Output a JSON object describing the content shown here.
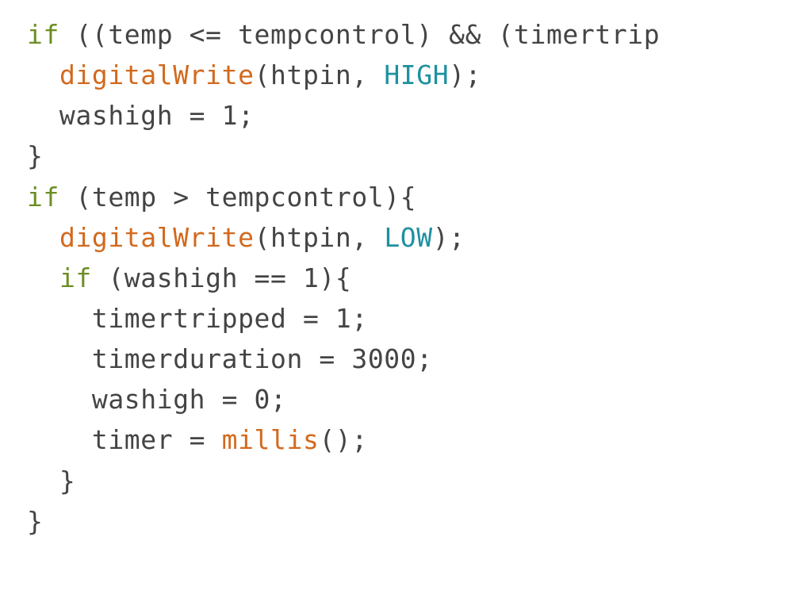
{
  "code": {
    "font_family": "monospace",
    "colors": {
      "keyword": "#6b8e23",
      "function": "#d2691e",
      "constant": "#1e90a0",
      "text": "#444444"
    },
    "lines": [
      [
        {
          "c": "kw",
          "t": "if"
        },
        {
          "c": "txt",
          "t": " ((temp <= tempcontrol) && (timertrip"
        }
      ],
      [
        {
          "c": "txt",
          "t": "  "
        },
        {
          "c": "fn",
          "t": "digitalWrite"
        },
        {
          "c": "txt",
          "t": "(htpin, "
        },
        {
          "c": "con",
          "t": "HIGH"
        },
        {
          "c": "txt",
          "t": ");"
        }
      ],
      [
        {
          "c": "txt",
          "t": "  washigh = 1;"
        }
      ],
      [
        {
          "c": "txt",
          "t": "}"
        }
      ],
      [
        {
          "c": "kw",
          "t": "if"
        },
        {
          "c": "txt",
          "t": " (temp > tempcontrol){"
        }
      ],
      [
        {
          "c": "txt",
          "t": "  "
        },
        {
          "c": "fn",
          "t": "digitalWrite"
        },
        {
          "c": "txt",
          "t": "(htpin, "
        },
        {
          "c": "con",
          "t": "LOW"
        },
        {
          "c": "txt",
          "t": ");"
        }
      ],
      [
        {
          "c": "txt",
          "t": "  "
        },
        {
          "c": "kw",
          "t": "if"
        },
        {
          "c": "txt",
          "t": " (washigh == 1){"
        }
      ],
      [
        {
          "c": "txt",
          "t": "    timertripped = 1;"
        }
      ],
      [
        {
          "c": "txt",
          "t": "    timerduration = 3000;"
        }
      ],
      [
        {
          "c": "txt",
          "t": "    washigh = 0;"
        }
      ],
      [
        {
          "c": "txt",
          "t": "    timer = "
        },
        {
          "c": "fn",
          "t": "millis"
        },
        {
          "c": "txt",
          "t": "();"
        }
      ],
      [
        {
          "c": "txt",
          "t": "  }"
        }
      ],
      [
        {
          "c": "txt",
          "t": "}"
        }
      ]
    ]
  }
}
